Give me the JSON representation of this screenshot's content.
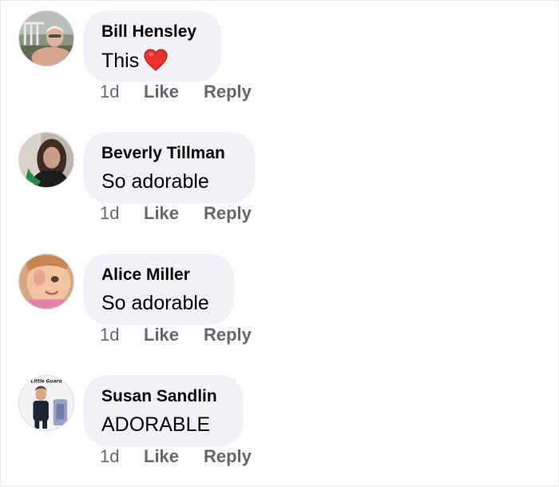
{
  "comments": [
    {
      "author": "Bill Hensley",
      "text": "This",
      "reaction_icon": "red-heart-icon",
      "time": "1d",
      "like_label": "Like",
      "reply_label": "Reply"
    },
    {
      "author": "Beverly Tillman",
      "text": "So adorable",
      "time": "1d",
      "like_label": "Like",
      "reply_label": "Reply"
    },
    {
      "author": "Alice Miller",
      "text": "So adorable",
      "time": "1d",
      "like_label": "Like",
      "reply_label": "Reply"
    },
    {
      "author": "Susan Sandlin",
      "text": "ADORABLE",
      "avatar_caption": "Little Guard",
      "time": "1d",
      "like_label": "Like",
      "reply_label": "Reply"
    }
  ],
  "colors": {
    "bubble_bg": "#f0f2f5",
    "secondary_text": "#65676b",
    "heart": "#e8332f"
  }
}
